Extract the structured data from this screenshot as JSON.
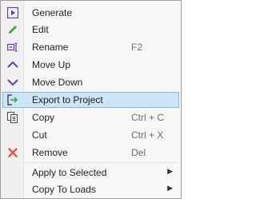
{
  "menu": {
    "items": [
      {
        "label": "Generate",
        "icon": "generate-icon"
      },
      {
        "label": "Edit",
        "icon": "pencil-icon"
      },
      {
        "label": "Rename",
        "shortcut": "F2",
        "icon": "rename-icon"
      },
      {
        "label": "Move Up",
        "icon": "chevron-up-icon"
      },
      {
        "label": "Move Down",
        "icon": "chevron-down-icon"
      },
      {
        "label": "Export to Project",
        "icon": "export-icon"
      },
      {
        "label": "Copy",
        "shortcut": "Ctrl + C",
        "icon": "copy-icon"
      },
      {
        "label": "Cut",
        "shortcut": "Ctrl + X"
      },
      {
        "label": "Remove",
        "shortcut": "Del",
        "icon": "remove-x-icon"
      },
      {
        "label": "Apply to Selected",
        "submenu_arrow": "▶"
      },
      {
        "label": "Copy To Loads",
        "submenu_arrow": "▶"
      }
    ],
    "selected_item": "Export to Project"
  },
  "colors": {
    "purple_icon": "#6b3aa8",
    "green_icon": "#3aa844",
    "red_x": "#d9534f",
    "selection_bg": "#cde6f7",
    "selection_border": "#7fb8e0"
  }
}
